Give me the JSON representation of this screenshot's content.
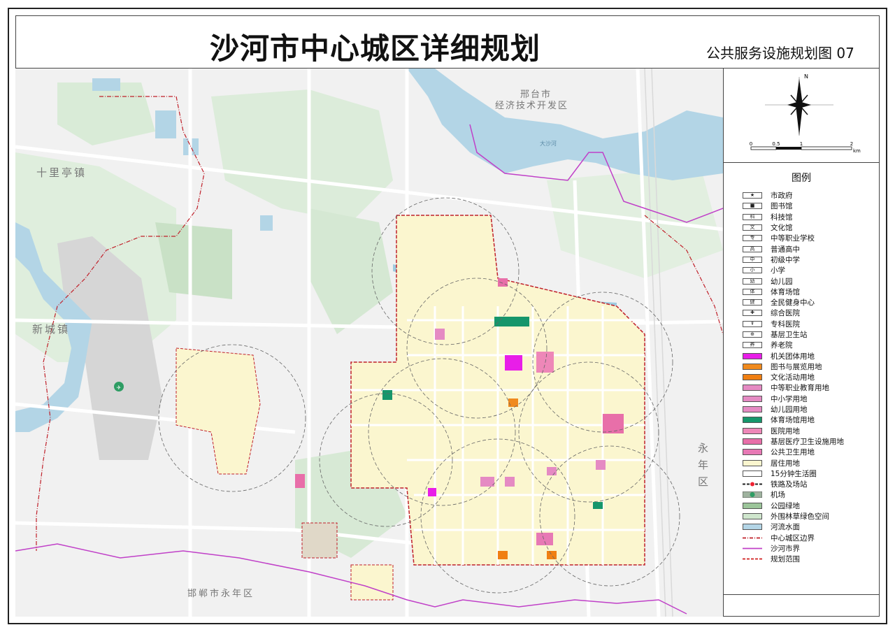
{
  "title": "沙河市中心城区详细规划",
  "sheet_title": "公共服务设施规划图 07",
  "map_labels": {
    "xingtai_dev": "邢台市",
    "xingtai_dev2": "经济技术开发区",
    "shilimiao": "十里亭镇",
    "xincheng": "新城镇",
    "handan": "邯郸市永年区",
    "yongnian_v1": "永",
    "yongnian_v2": "年",
    "yongnian_v3": "区",
    "river": "大沙河"
  },
  "scale_bar": {
    "labels": [
      "0",
      "0.5",
      "1",
      "2"
    ],
    "unit": "km"
  },
  "compass": {
    "north": "N"
  },
  "legend": {
    "title": "图例",
    "items": [
      {
        "label": "市政府",
        "symbol": "★",
        "kind": "box",
        "fill": "#ffffff"
      },
      {
        "label": "图书馆",
        "symbol": "■",
        "kind": "box",
        "fill": "#ffffff"
      },
      {
        "label": "科技馆",
        "symbol": "科",
        "kind": "box",
        "fill": "#ffffff"
      },
      {
        "label": "文化馆",
        "symbol": "文",
        "kind": "box",
        "fill": "#ffffff"
      },
      {
        "label": "中等职业学校",
        "symbol": "专",
        "kind": "box",
        "fill": "#ffffff"
      },
      {
        "label": "普通高中",
        "symbol": "高",
        "kind": "box",
        "fill": "#ffffff"
      },
      {
        "label": "初级中学",
        "symbol": "中",
        "kind": "box",
        "fill": "#ffffff"
      },
      {
        "label": "小学",
        "symbol": "小",
        "kind": "box",
        "fill": "#ffffff"
      },
      {
        "label": "幼儿园",
        "symbol": "幼",
        "kind": "box",
        "fill": "#ffffff"
      },
      {
        "label": "体育场馆",
        "symbol": "体",
        "kind": "box",
        "fill": "#ffffff"
      },
      {
        "label": "全民健身中心",
        "symbol": "健",
        "kind": "box",
        "fill": "#ffffff"
      },
      {
        "label": "综合医院",
        "symbol": "✚",
        "kind": "box",
        "fill": "#ffffff"
      },
      {
        "label": "专科医院",
        "symbol": "☤",
        "kind": "box",
        "fill": "#ffffff"
      },
      {
        "label": "基层卫生站",
        "symbol": "⊕",
        "kind": "box",
        "fill": "#ffffff"
      },
      {
        "label": "养老院",
        "symbol": "养",
        "kind": "box",
        "fill": "#ffffff"
      },
      {
        "label": "机关团体用地",
        "symbol": "",
        "kind": "fill",
        "fill": "#e81ee8"
      },
      {
        "label": "图书与展览用地",
        "symbol": "",
        "kind": "fill",
        "fill": "#f08a1e"
      },
      {
        "label": "文化活动用地",
        "symbol": "",
        "kind": "fill",
        "fill": "#f07f12"
      },
      {
        "label": "中等职业教育用地",
        "symbol": "",
        "kind": "fill",
        "fill": "#e58ac3"
      },
      {
        "label": "中小学用地",
        "symbol": "",
        "kind": "fill",
        "fill": "#e58ac3"
      },
      {
        "label": "幼儿园用地",
        "symbol": "",
        "kind": "fill",
        "fill": "#e58ac3"
      },
      {
        "label": "体育场馆用地",
        "symbol": "",
        "kind": "fill",
        "fill": "#16966b"
      },
      {
        "label": "医院用地",
        "symbol": "",
        "kind": "fill",
        "fill": "#ee87b8"
      },
      {
        "label": "基层医疗卫生设施用地",
        "symbol": "",
        "kind": "fill",
        "fill": "#e86fa9"
      },
      {
        "label": "公共卫生用地",
        "symbol": "",
        "kind": "fill",
        "fill": "#e779b5"
      },
      {
        "label": "居住用地",
        "symbol": "",
        "kind": "fill",
        "fill": "#fbf6cf"
      },
      {
        "label": "15分钟生活圈",
        "symbol": "",
        "kind": "fill",
        "fill": "#ffffff"
      },
      {
        "label": "铁路及场站",
        "symbol": "",
        "kind": "rail",
        "fill": "#ffffff"
      },
      {
        "label": "机场",
        "symbol": "✈",
        "kind": "airport",
        "fill": "#9fb39f"
      },
      {
        "label": "公园绿地",
        "symbol": "",
        "kind": "fill",
        "fill": "#9cc59a"
      },
      {
        "label": "外围林草绿色空间",
        "symbol": "",
        "kind": "fill",
        "fill": "#cfe6cd"
      },
      {
        "label": "河流水面",
        "symbol": "",
        "kind": "fill",
        "fill": "#b3d5e6"
      },
      {
        "label": "中心城区边界",
        "symbol": "",
        "kind": "dashline",
        "fill": "#c0202a"
      },
      {
        "label": "沙河市界",
        "symbol": "",
        "kind": "purpleline",
        "fill": "#c040c8"
      },
      {
        "label": "规划范围",
        "symbol": "",
        "kind": "redline",
        "fill": "#d01e1e"
      }
    ]
  },
  "colors": {
    "residential": "#fbf6cf",
    "water": "#b3d5e6",
    "green_outer": "#cfe6cd",
    "park": "#9cc59a",
    "road": "#ffffff",
    "base": "#f1f1f1",
    "boundary_red": "#c0202a",
    "boundary_purple": "#c040c8",
    "public": "#e81ee8",
    "edu": "#e58ac3",
    "sport": "#16966b",
    "culture": "#f08a1e"
  }
}
